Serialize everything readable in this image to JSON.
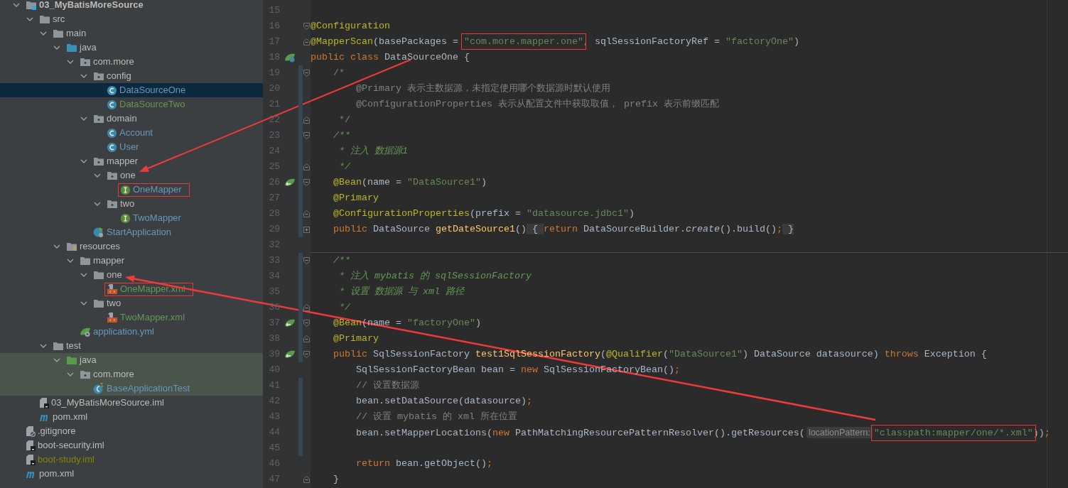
{
  "project_tree": {
    "items": [
      {
        "name": "03_MyBatisMoreSource",
        "kind": "module",
        "color": "#bbbbbb",
        "expanded": true,
        "selected": false,
        "boxed": false,
        "test_scope": false,
        "children": [
          {
            "name": "src",
            "kind": "folder",
            "color": "#bbbbbb",
            "expanded": true,
            "selected": false,
            "boxed": false,
            "test_scope": false,
            "children": [
              {
                "name": "main",
                "kind": "folder",
                "color": "#bbbbbb",
                "expanded": true,
                "selected": false,
                "boxed": false,
                "test_scope": false,
                "children": [
                  {
                    "name": "java",
                    "kind": "source-root",
                    "color": "#bbbbbb",
                    "expanded": true,
                    "selected": false,
                    "boxed": false,
                    "test_scope": false,
                    "children": [
                      {
                        "name": "com.more",
                        "kind": "package",
                        "color": "#bbbbbb",
                        "expanded": true,
                        "selected": false,
                        "boxed": false,
                        "test_scope": false,
                        "children": [
                          {
                            "name": "config",
                            "kind": "package",
                            "color": "#bbbbbb",
                            "expanded": true,
                            "selected": false,
                            "boxed": false,
                            "test_scope": false,
                            "children": [
                              {
                                "name": "DataSourceOne",
                                "kind": "class",
                                "color": "#6897bb",
                                "selected": true,
                                "boxed": false,
                                "test_scope": false
                              },
                              {
                                "name": "DataSourceTwo",
                                "kind": "class",
                                "color": "#629755",
                                "selected": false,
                                "boxed": false,
                                "test_scope": false
                              }
                            ]
                          },
                          {
                            "name": "domain",
                            "kind": "package",
                            "color": "#bbbbbb",
                            "expanded": true,
                            "selected": false,
                            "boxed": false,
                            "test_scope": false,
                            "children": [
                              {
                                "name": "Account",
                                "kind": "class",
                                "color": "#6897bb",
                                "selected": false,
                                "boxed": false,
                                "test_scope": false
                              },
                              {
                                "name": "User",
                                "kind": "class",
                                "color": "#6897bb",
                                "selected": false,
                                "boxed": false,
                                "test_scope": false
                              }
                            ]
                          },
                          {
                            "name": "mapper",
                            "kind": "package",
                            "color": "#bbbbbb",
                            "expanded": true,
                            "selected": false,
                            "boxed": false,
                            "test_scope": false,
                            "children": [
                              {
                                "name": "one",
                                "kind": "package",
                                "color": "#bbbbbb",
                                "expanded": true,
                                "selected": false,
                                "boxed": false,
                                "test_scope": false,
                                "children": [
                                  {
                                    "name": "OneMapper",
                                    "kind": "interface",
                                    "color": "#6897bb",
                                    "selected": false,
                                    "boxed": true,
                                    "test_scope": false
                                  }
                                ]
                              },
                              {
                                "name": "two",
                                "kind": "package",
                                "color": "#bbbbbb",
                                "expanded": true,
                                "selected": false,
                                "boxed": false,
                                "test_scope": false,
                                "children": [
                                  {
                                    "name": "TwoMapper",
                                    "kind": "interface",
                                    "color": "#6897bb",
                                    "selected": false,
                                    "boxed": false,
                                    "test_scope": false
                                  }
                                ]
                              }
                            ]
                          },
                          {
                            "name": "StartApplication",
                            "kind": "boot-class",
                            "color": "#6897bb",
                            "selected": false,
                            "boxed": false,
                            "test_scope": false
                          }
                        ]
                      }
                    ]
                  },
                  {
                    "name": "resources",
                    "kind": "resources-root",
                    "color": "#bbbbbb",
                    "expanded": true,
                    "selected": false,
                    "boxed": false,
                    "test_scope": false,
                    "children": [
                      {
                        "name": "mapper",
                        "kind": "folder",
                        "color": "#bbbbbb",
                        "expanded": true,
                        "selected": false,
                        "boxed": false,
                        "test_scope": false,
                        "children": [
                          {
                            "name": "one",
                            "kind": "folder",
                            "color": "#bbbbbb",
                            "expanded": true,
                            "selected": false,
                            "boxed": false,
                            "test_scope": false,
                            "children": [
                              {
                                "name": "OneMapper.xml",
                                "kind": "xml",
                                "color": "#629755",
                                "selected": false,
                                "boxed": true,
                                "test_scope": false
                              }
                            ]
                          },
                          {
                            "name": "two",
                            "kind": "folder",
                            "color": "#bbbbbb",
                            "expanded": true,
                            "selected": false,
                            "boxed": false,
                            "test_scope": false,
                            "children": [
                              {
                                "name": "TwoMapper.xml",
                                "kind": "xml",
                                "color": "#629755",
                                "selected": false,
                                "boxed": false,
                                "test_scope": false
                              }
                            ]
                          }
                        ]
                      },
                      {
                        "name": "application.yml",
                        "kind": "yml",
                        "color": "#6897bb",
                        "selected": false,
                        "boxed": false,
                        "test_scope": false
                      }
                    ]
                  }
                ]
              },
              {
                "name": "test",
                "kind": "folder",
                "color": "#bbbbbb",
                "expanded": true,
                "selected": false,
                "boxed": false,
                "test_scope": false,
                "children": [
                  {
                    "name": "java",
                    "kind": "test-root",
                    "color": "#bbbbbb",
                    "expanded": true,
                    "selected": false,
                    "boxed": false,
                    "test_scope": true,
                    "children": [
                      {
                        "name": "com.more",
                        "kind": "package",
                        "color": "#bbbbbb",
                        "expanded": true,
                        "selected": false,
                        "boxed": false,
                        "test_scope": true,
                        "children": [
                          {
                            "name": "BaseApplicationTest",
                            "kind": "test-class",
                            "color": "#6897bb",
                            "selected": false,
                            "boxed": false,
                            "test_scope": true
                          }
                        ]
                      }
                    ]
                  }
                ]
              }
            ]
          },
          {
            "name": "03_MyBatisMoreSource.iml",
            "kind": "iml",
            "color": "#bbbbbb",
            "selected": false,
            "boxed": false,
            "test_scope": false
          },
          {
            "name": "pom.xml",
            "kind": "maven",
            "color": "#bbbbbb",
            "selected": false,
            "boxed": false,
            "test_scope": false
          }
        ]
      },
      {
        "name": ".gitignore",
        "kind": "gitignore",
        "color": "#bbbbbb",
        "selected": false,
        "boxed": false,
        "test_scope": false
      },
      {
        "name": "boot-security.iml",
        "kind": "iml",
        "color": "#bbbbbb",
        "selected": false,
        "boxed": false,
        "test_scope": false
      },
      {
        "name": "boot-study.iml",
        "kind": "iml",
        "color": "#848504",
        "selected": false,
        "boxed": false,
        "test_scope": false
      },
      {
        "name": "pom.xml",
        "kind": "maven",
        "color": "#bbbbbb",
        "selected": false,
        "boxed": false,
        "test_scope": false
      }
    ]
  },
  "editor": {
    "lines": [
      {
        "number": "15",
        "changed": false,
        "separator": false
      },
      {
        "number": "16",
        "fold": {
          "kind": "start"
        },
        "changed": false,
        "separator": false,
        "tokens": [
          {
            "kind": "ann",
            "text": "@Configuration"
          }
        ]
      },
      {
        "number": "17",
        "fold": {
          "kind": "end"
        },
        "changed": false,
        "separator": false,
        "tokens": [
          {
            "kind": "ann",
            "text": "@MapperScan"
          },
          {
            "kind": "plain",
            "text": "(basePackages = "
          },
          {
            "kind": "str",
            "text": "\"com.more.mapper.one\"",
            "boxed": true
          },
          {
            "kind": "kw",
            "text": ","
          },
          {
            "kind": "plain",
            "text": " sqlSessionFactoryRef = "
          },
          {
            "kind": "str",
            "text": "\"factoryOne\""
          },
          {
            "kind": "plain",
            "text": ")"
          }
        ]
      },
      {
        "number": "18",
        "gutter_icon": {
          "kind": "bean-class"
        },
        "changed": false,
        "separator": false,
        "tokens": [
          {
            "kind": "kw",
            "text": "public class "
          },
          {
            "kind": "plain",
            "text": "DataSourceOne {"
          }
        ]
      },
      {
        "number": "19",
        "fold": {
          "kind": "start"
        },
        "changed": true,
        "separator": false,
        "tokens": [
          {
            "kind": "cmt",
            "text": "    /*"
          }
        ]
      },
      {
        "number": "20",
        "changed": true,
        "separator": false,
        "tokens": [
          {
            "kind": "cmt",
            "text": "        @Primary 表示主数据源，未指定使用哪个数据源时默认使用"
          }
        ]
      },
      {
        "number": "21",
        "changed": true,
        "separator": false,
        "tokens": [
          {
            "kind": "cmt",
            "text": "        @ConfigurationProperties 表示从配置文件中获取取值， prefix 表示前缀匹配"
          }
        ]
      },
      {
        "number": "22",
        "fold": {
          "kind": "end"
        },
        "changed": true,
        "separator": false,
        "tokens": [
          {
            "kind": "cmt",
            "text": "     */"
          }
        ]
      },
      {
        "number": "23",
        "fold": {
          "kind": "start"
        },
        "changed": true,
        "separator": false,
        "tokens": [
          {
            "kind": "doc",
            "text": "    /**"
          }
        ]
      },
      {
        "number": "24",
        "changed": true,
        "separator": false,
        "tokens": [
          {
            "kind": "doc",
            "text": "     * 注入 数据源1"
          }
        ]
      },
      {
        "number": "25",
        "fold": {
          "kind": "end"
        },
        "changed": true,
        "separator": false,
        "tokens": [
          {
            "kind": "doc",
            "text": "     */"
          }
        ]
      },
      {
        "number": "26",
        "gutter_icon": {
          "kind": "bean"
        },
        "fold": {
          "kind": "start"
        },
        "changed": true,
        "separator": false,
        "tokens": [
          {
            "kind": "ann",
            "text": "    @Bean"
          },
          {
            "kind": "plain",
            "text": "(name = "
          },
          {
            "kind": "str",
            "text": "\"DataSource1\""
          },
          {
            "kind": "plain",
            "text": ")"
          }
        ]
      },
      {
        "number": "27",
        "changed": true,
        "separator": false,
        "tokens": [
          {
            "kind": "ann",
            "text": "    @Primary"
          }
        ]
      },
      {
        "number": "28",
        "fold": {
          "kind": "end"
        },
        "changed": true,
        "separator": false,
        "tokens": [
          {
            "kind": "ann",
            "text": "    @ConfigurationProperties"
          },
          {
            "kind": "plain",
            "text": "(prefix = "
          },
          {
            "kind": "str",
            "text": "\"datasource.jdbc1\""
          },
          {
            "kind": "plain",
            "text": ")"
          }
        ]
      },
      {
        "number": "29",
        "fold": {
          "kind": "collapsed"
        },
        "changed": true,
        "separator": false,
        "tokens": [
          {
            "kind": "kw",
            "text": "    public "
          },
          {
            "kind": "plain",
            "text": "DataSource "
          },
          {
            "kind": "fn",
            "text": "getDateSource1"
          },
          {
            "kind": "plain",
            "text": "()"
          },
          {
            "kind": "folded",
            "text": " { "
          },
          {
            "kind": "kw",
            "text": "return "
          },
          {
            "kind": "plain",
            "text": "DataSourceBuilder."
          },
          {
            "kind": "italic",
            "text": "create"
          },
          {
            "kind": "plain",
            "text": "().build()"
          },
          {
            "kind": "kw",
            "text": ";"
          },
          {
            "kind": "folded",
            "text": " }"
          }
        ]
      },
      {
        "number": "32",
        "changed": false,
        "separator": true
      },
      {
        "number": "33",
        "fold": {
          "kind": "start"
        },
        "changed": true,
        "separator": false,
        "tokens": [
          {
            "kind": "doc",
            "text": "    /**"
          }
        ]
      },
      {
        "number": "34",
        "changed": true,
        "separator": false,
        "tokens": [
          {
            "kind": "doc",
            "text": "     * 注入 mybatis 的 sqlSessionFactory"
          }
        ]
      },
      {
        "number": "35",
        "changed": true,
        "separator": false,
        "tokens": [
          {
            "kind": "doc",
            "text": "     * 设置 数据源 与 xml 路径"
          }
        ]
      },
      {
        "number": "36",
        "fold": {
          "kind": "end"
        },
        "changed": true,
        "separator": false,
        "tokens": [
          {
            "kind": "doc",
            "text": "     */"
          }
        ]
      },
      {
        "number": "37",
        "gutter_icon": {
          "kind": "bean"
        },
        "fold": {
          "kind": "start"
        },
        "changed": true,
        "separator": false,
        "tokens": [
          {
            "kind": "ann",
            "text": "    @Bean"
          },
          {
            "kind": "plain",
            "text": "(name = "
          },
          {
            "kind": "str",
            "text": "\"factoryOne\""
          },
          {
            "kind": "plain",
            "text": ")"
          }
        ]
      },
      {
        "number": "38",
        "fold": {
          "kind": "end"
        },
        "changed": true,
        "separator": false,
        "tokens": [
          {
            "kind": "ann",
            "text": "    @Primary"
          }
        ]
      },
      {
        "number": "39",
        "gutter_icon": {
          "kind": "bean"
        },
        "fold": {
          "kind": "start"
        },
        "changed": true,
        "separator": false,
        "tokens": [
          {
            "kind": "kw",
            "text": "    public "
          },
          {
            "kind": "plain",
            "text": "SqlSessionFactory "
          },
          {
            "kind": "fn",
            "text": "test1SqlSessionFactory"
          },
          {
            "kind": "plain",
            "text": "("
          },
          {
            "kind": "ann",
            "text": "@Qualifier"
          },
          {
            "kind": "plain",
            "text": "("
          },
          {
            "kind": "str",
            "text": "\"DataSource1\""
          },
          {
            "kind": "plain",
            "text": ") DataSource datasource) "
          },
          {
            "kind": "kw",
            "text": "throws "
          },
          {
            "kind": "plain",
            "text": "Exception {"
          }
        ]
      },
      {
        "number": "40",
        "changed": false,
        "separator": false,
        "tokens": [
          {
            "kind": "plain",
            "text": "        SqlSessionFactoryBean bean = "
          },
          {
            "kind": "kw",
            "text": "new "
          },
          {
            "kind": "plain",
            "text": "SqlSessionFactoryBean()"
          },
          {
            "kind": "kw",
            "text": ";"
          }
        ]
      },
      {
        "number": "41",
        "changed": true,
        "separator": false,
        "tokens": [
          {
            "kind": "cmt",
            "text": "        // 设置数据源"
          }
        ]
      },
      {
        "number": "42",
        "changed": true,
        "separator": false,
        "tokens": [
          {
            "kind": "plain",
            "text": "        bean.setDataSource(datasource)"
          },
          {
            "kind": "kw",
            "text": ";"
          }
        ]
      },
      {
        "number": "43",
        "changed": true,
        "separator": false,
        "tokens": [
          {
            "kind": "cmt",
            "text": "        // 设置 mybatis 的 xml 所在位置"
          }
        ]
      },
      {
        "number": "44",
        "changed": true,
        "separator": false,
        "tokens": [
          {
            "kind": "plain",
            "text": "        bean.setMapperLocations("
          },
          {
            "kind": "kw",
            "text": "new "
          },
          {
            "kind": "plain",
            "text": "PathMatchingResourcePatternResolver().getResources("
          },
          {
            "kind": "hint",
            "text": "locationPattern:"
          },
          {
            "kind": "str",
            "text": "\"classpath:mapper/one/*.xml\"",
            "boxed": true
          },
          {
            "kind": "plain",
            "text": "))"
          },
          {
            "kind": "kw",
            "text": ";"
          }
        ]
      },
      {
        "number": "45",
        "changed": true,
        "separator": false
      },
      {
        "number": "46",
        "changed": false,
        "separator": false,
        "tokens": [
          {
            "kind": "kw",
            "text": "        return "
          },
          {
            "kind": "plain",
            "text": "bean.getObject()"
          },
          {
            "kind": "kw",
            "text": ";"
          }
        ]
      },
      {
        "number": "47",
        "fold": {
          "kind": "end"
        },
        "changed": false,
        "separator": false,
        "tokens": [
          {
            "kind": "plain",
            "text": "    }"
          }
        ]
      }
    ]
  }
}
